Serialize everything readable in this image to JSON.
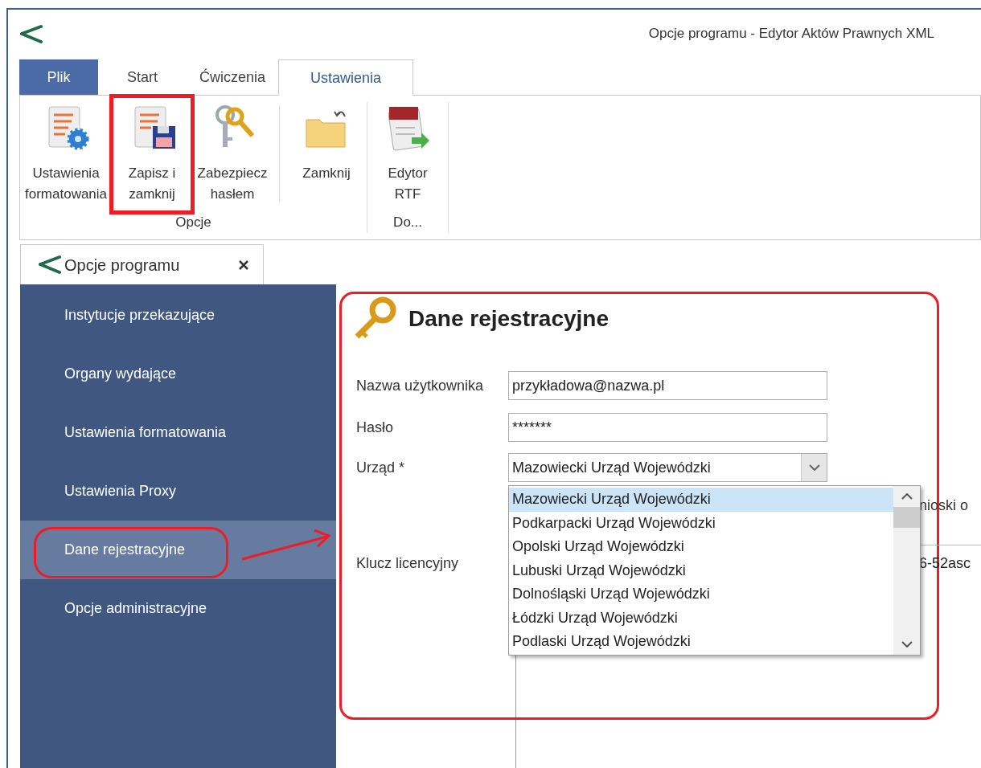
{
  "window": {
    "title": "Opcje programu - Edytor Aktów Prawnych XML"
  },
  "ribbon_tabs": [
    {
      "label": "Plik",
      "kind": "file",
      "selected": false
    },
    {
      "label": "Start",
      "kind": "tab",
      "selected": false
    },
    {
      "label": "Ćwiczenia",
      "kind": "tab",
      "selected": false
    },
    {
      "label": "Ustawienia",
      "kind": "tab",
      "selected": true
    }
  ],
  "ribbon_groups": [
    {
      "label": "Opcje",
      "buttons": [
        {
          "label": "Ustawienia\nformatowania",
          "kind": "format-settings",
          "highlighted": false,
          "separator_before": false
        },
        {
          "label": "Zapisz i\nzamknij",
          "kind": "save-close",
          "highlighted": true,
          "separator_before": false
        },
        {
          "label": "Zabezpiecz\nhasłem",
          "kind": "password",
          "highlighted": false,
          "separator_before": false
        },
        {
          "label": "Zamknij",
          "kind": "close",
          "highlighted": false,
          "separator_before": true
        }
      ]
    },
    {
      "label": "Do...",
      "buttons": [
        {
          "label": "Edytor\nRTF",
          "kind": "rtf",
          "highlighted": false,
          "separator_before": false
        }
      ]
    }
  ],
  "document_tab": {
    "label": "Opcje programu",
    "closable": true
  },
  "sidebar": {
    "items": [
      {
        "label": "Instytucje przekazujące",
        "selected": false,
        "highlighted": false
      },
      {
        "label": "Organy wydające",
        "selected": false,
        "highlighted": false
      },
      {
        "label": "Ustawienia formatowania",
        "selected": false,
        "highlighted": false
      },
      {
        "label": "Ustawienia Proxy",
        "selected": false,
        "highlighted": false
      },
      {
        "label": "Dane rejestracyjne",
        "selected": true,
        "highlighted": true
      },
      {
        "label": "Opcje administracyjne",
        "selected": false,
        "highlighted": false
      }
    ]
  },
  "panel": {
    "title": "Dane rejestracyjne",
    "highlighted": true,
    "fields": [
      {
        "label": "Nazwa użytkownika",
        "kind": "text",
        "value": "przykładowa@nazwa.pl"
      },
      {
        "label": "Hasło",
        "kind": "password",
        "value": "*******"
      },
      {
        "label": "Urząd *",
        "kind": "dropdown",
        "value": "Mazowiecki Urząd Wojewódzki",
        "expanded": true,
        "options": [
          {
            "label": "Mazowiecki Urząd Wojewódzki",
            "selected": true
          },
          {
            "label": "Podkarpacki Urząd Wojewódzki",
            "selected": false
          },
          {
            "label": "Opolski Urząd Wojewódzki",
            "selected": false
          },
          {
            "label": "Lubuski Urząd Wojewódzki",
            "selected": false
          },
          {
            "label": "Dolnośląski Urząd Wojewódzki",
            "selected": false
          },
          {
            "label": "Łódzki Urząd Wojewódzki",
            "selected": false
          },
          {
            "label": "Podlaski Urząd Wojewódzki",
            "selected": false
          }
        ]
      },
      {
        "kind": "partial-note",
        "value": "nioski o"
      },
      {
        "label": "Klucz licencyjny",
        "kind": "license",
        "value": "6-52asc"
      }
    ]
  }
}
